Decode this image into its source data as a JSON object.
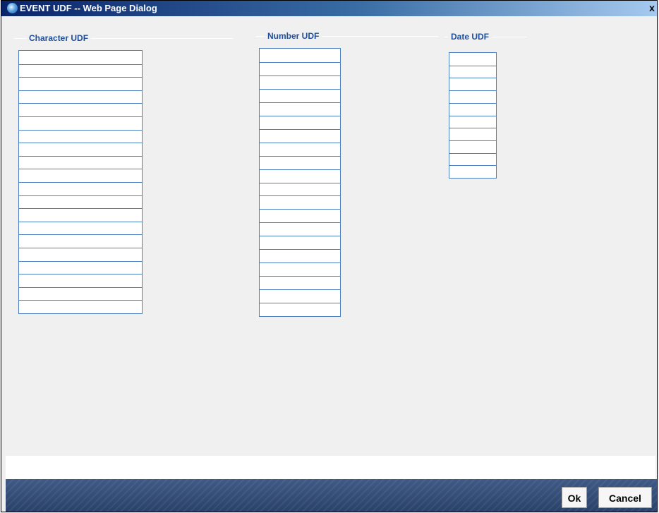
{
  "window": {
    "title": "EVENT UDF -- Web Page Dialog"
  },
  "groups": {
    "character": {
      "title": "Character UDF",
      "fields": 20
    },
    "number": {
      "title": "Number UDF",
      "fields": 20
    },
    "date": {
      "title": "Date UDF",
      "fields": 10
    }
  },
  "footer": {
    "ok_label": "Ok",
    "cancel_label": "Cancel"
  },
  "colors": {
    "title_text": "#1f4f9c",
    "field_border": "#4a7fc1",
    "footer_bg": "#2a4269"
  }
}
